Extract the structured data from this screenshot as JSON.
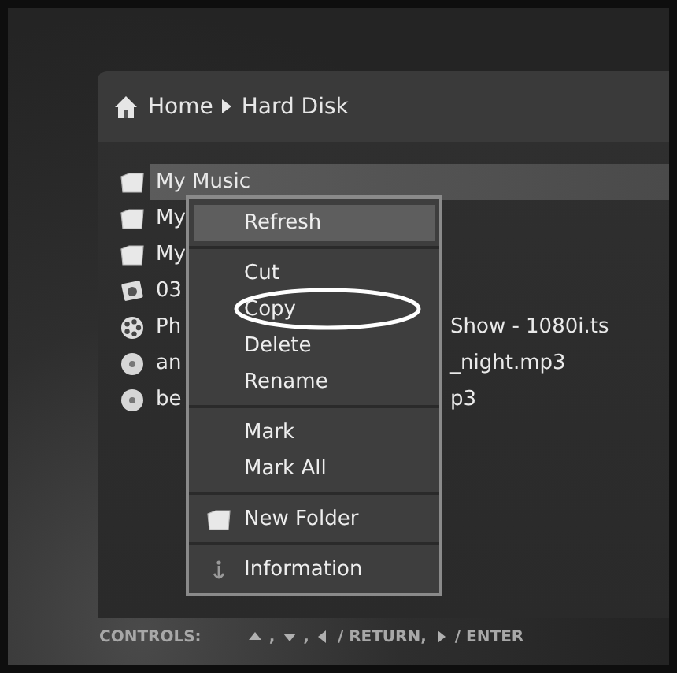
{
  "breadcrumb": [
    {
      "label": "Home"
    },
    {
      "label": "Hard Disk"
    }
  ],
  "files": [
    {
      "kind": "folder",
      "name": "My Music",
      "selected": true
    },
    {
      "kind": "folder",
      "name": "My",
      "selected": false
    },
    {
      "kind": "folder",
      "name": "My",
      "selected": false
    },
    {
      "kind": "photo",
      "name": "03",
      "selected": false
    },
    {
      "kind": "video",
      "name": "Ph",
      "name_end": "Show - 1080i.ts",
      "selected": false
    },
    {
      "kind": "audio",
      "name": "an",
      "name_end": "_night.mp3",
      "selected": false
    },
    {
      "kind": "audio",
      "name": "be",
      "name_end": "p3",
      "selected": false
    }
  ],
  "context_menu": {
    "groups": [
      [
        {
          "kind": "plain",
          "label": "Refresh",
          "selected": true,
          "circled": false
        }
      ],
      [
        {
          "kind": "plain",
          "label": "Cut",
          "selected": false,
          "circled": false
        },
        {
          "kind": "plain",
          "label": "Copy",
          "selected": false,
          "circled": true
        },
        {
          "kind": "plain",
          "label": "Delete",
          "selected": false,
          "circled": false
        },
        {
          "kind": "plain",
          "label": "Rename",
          "selected": false,
          "circled": false
        }
      ],
      [
        {
          "kind": "plain",
          "label": "Mark",
          "selected": false,
          "circled": false
        },
        {
          "kind": "plain",
          "label": "Mark All",
          "selected": false,
          "circled": false
        }
      ],
      [
        {
          "kind": "folder",
          "label": "New Folder",
          "selected": false,
          "circled": false
        }
      ],
      [
        {
          "kind": "info",
          "label": "Information",
          "selected": false,
          "circled": false
        }
      ]
    ]
  },
  "controls": {
    "label": "CONTROLS:",
    "keys": [
      {
        "kind": "up",
        "text": ","
      },
      {
        "kind": "down",
        "text": ","
      },
      {
        "kind": "left",
        "text": "/ RETURN,"
      },
      {
        "kind": "right",
        "text": "/ ENTER"
      }
    ]
  }
}
